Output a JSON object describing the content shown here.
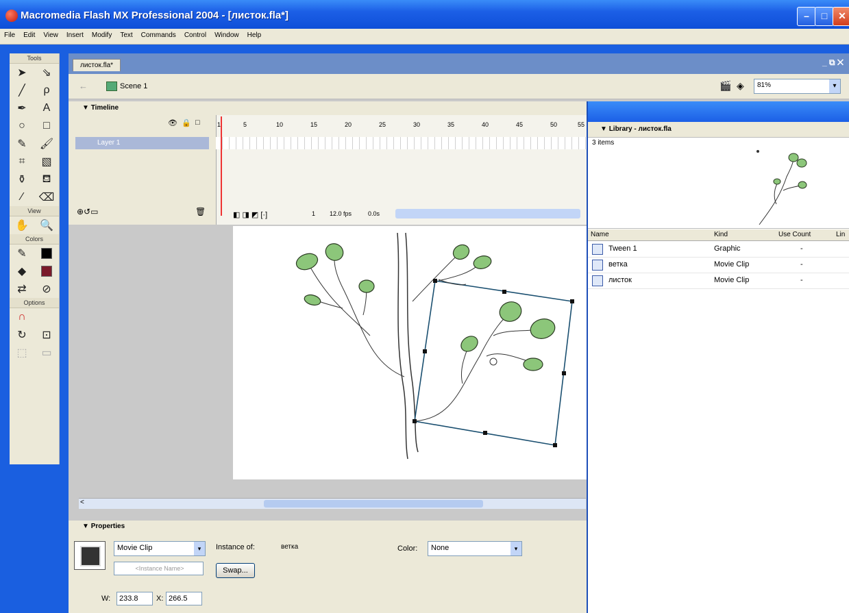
{
  "window": {
    "title": "Macromedia Flash MX Professional 2004 - [листок.fla*]",
    "buttons": {
      "minimize": "–",
      "maximize": "□",
      "close": "✕"
    }
  },
  "menu": [
    "File",
    "Edit",
    "View",
    "Insert",
    "Modify",
    "Text",
    "Commands",
    "Control",
    "Window",
    "Help"
  ],
  "tools": {
    "title": "Tools",
    "view_label": "View",
    "colors_label": "Colors",
    "options_label": "Options"
  },
  "document": {
    "tab": "листок.fla*",
    "scene": "Scene 1",
    "zoom": "81%",
    "doc_controls": "_ ⧉ ✕"
  },
  "timeline": {
    "title": "Timeline",
    "layer": "Layer 1",
    "frame_numbers": [
      "1",
      "5",
      "10",
      "15",
      "20",
      "25",
      "30",
      "35",
      "40",
      "45",
      "50",
      "55"
    ],
    "current_frame": "1",
    "fps": "12.0 fps",
    "elapsed": "0.0s"
  },
  "library": {
    "title": "Library - листок.fla",
    "count": "3 items",
    "columns": [
      "Name",
      "Kind",
      "Use Count",
      "Lin"
    ],
    "items": [
      {
        "name": "Tween 1",
        "kind": "Graphic",
        "use_count": "-"
      },
      {
        "name": "ветка",
        "kind": "Movie Clip",
        "use_count": "-"
      },
      {
        "name": "листок",
        "kind": "Movie Clip",
        "use_count": "-"
      }
    ]
  },
  "properties": {
    "title": "Properties",
    "symbol_type": "Movie Clip",
    "instance_name_placeholder": "<Instance Name>",
    "instance_of_label": "Instance of:",
    "instance_of_value": "ветка",
    "swap_button": "Swap...",
    "color_label": "Color:",
    "color_value": "None",
    "w_label": "W:",
    "w_value": "233.8",
    "x_label": "X:",
    "x_value": "266.5"
  },
  "colors": {
    "accent": "#1c5fe6",
    "leaf": "#7bbf6a",
    "selection": "#1a4f70"
  }
}
